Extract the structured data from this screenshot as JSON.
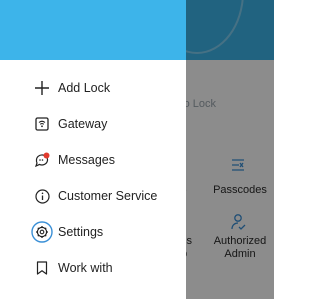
{
  "menu": {
    "items": [
      {
        "label": "Add Lock",
        "icon": "plus-icon"
      },
      {
        "label": "Gateway",
        "icon": "gateway-icon"
      },
      {
        "label": "Messages",
        "icon": "messages-icon"
      },
      {
        "label": "Customer Service",
        "icon": "info-icon"
      },
      {
        "label": "Settings",
        "icon": "settings-gear-icon"
      },
      {
        "label": "Work with",
        "icon": "bookmark-icon"
      }
    ]
  },
  "background": {
    "hint_text": "s to Lock",
    "tiles": [
      {
        "label": "Passcodes",
        "icon": "passcodes-icon"
      },
      {
        "label": "Authorized\nAdmin",
        "icon": "authorized-admin-icon"
      }
    ],
    "clipped_fragments": [
      "s",
      "ss",
      "b"
    ]
  },
  "colors": {
    "header_blue": "#3db4ea",
    "icon_blue": "#3a8fd6",
    "messages_red": "#e23b2e"
  }
}
